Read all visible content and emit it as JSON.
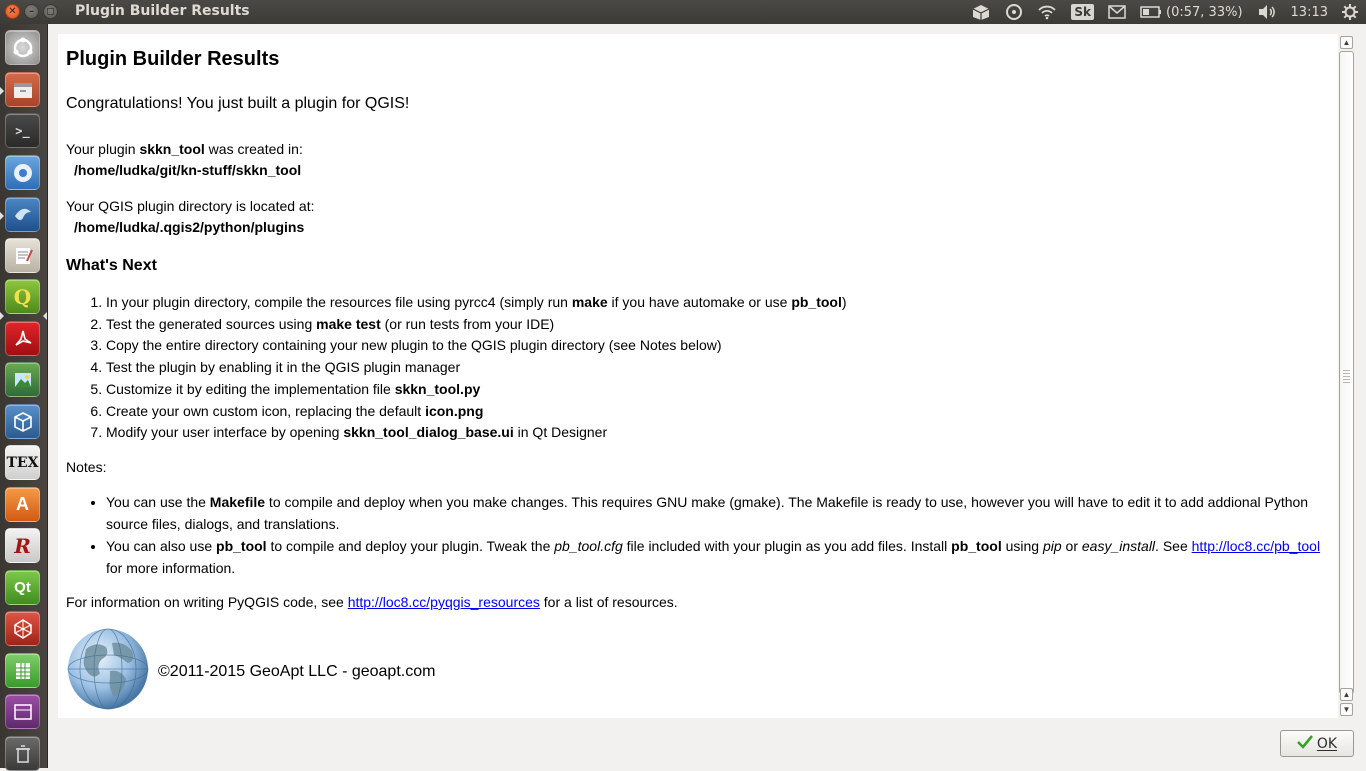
{
  "window": {
    "title": "Plugin Builder Results"
  },
  "panel": {
    "keyboard_layout": "Sk",
    "battery": "(0:57, 33%)",
    "clock": "13:13"
  },
  "launcher": {
    "items": [
      "ubuntu-dash",
      "file-manager",
      "terminal",
      "chromium",
      "thunderbird",
      "text-editor",
      "qgis",
      "pdf-reader",
      "image-viewer",
      "virtualbox",
      "texmaker",
      "software-center",
      "rstudio",
      "qt-creator",
      "network-tool",
      "spreadsheet",
      "workspace-switcher",
      "trash"
    ]
  },
  "content": {
    "heading": "Plugin Builder Results",
    "congrats": "Congratulations! You just built a plugin for QGIS!",
    "created_prefix": "Your plugin ",
    "plugin_name": "skkn_tool",
    "created_suffix": " was created in:",
    "created_path": "/home/ludka/git/kn-stuff/skkn_tool",
    "plugindir_label": "Your QGIS plugin directory is located at:",
    "plugindir_path": "/home/ludka/.qgis2/python/plugins",
    "whats_next": "What's Next",
    "steps": {
      "s1": {
        "a": "In your plugin directory, compile the resources file using pyrcc4 (simply run ",
        "b": "make",
        "c": " if you have automake or use ",
        "d": "pb_tool",
        "e": ")"
      },
      "s2": {
        "a": "Test the generated sources using ",
        "b": "make test",
        "c": " (or run tests from your IDE)"
      },
      "s3": {
        "a": "Copy the entire directory containing your new plugin to the QGIS plugin directory (see Notes below)"
      },
      "s4": {
        "a": "Test the plugin by enabling it in the QGIS plugin manager"
      },
      "s5": {
        "a": "Customize it by editing the implementation file ",
        "b": "skkn_tool.py"
      },
      "s6": {
        "a": "Create your own custom icon, replacing the default ",
        "b": "icon.png"
      },
      "s7": {
        "a": "Modify your user interface by opening ",
        "b": "skkn_tool_dialog_base.ui",
        "c": " in Qt Designer"
      }
    },
    "notes_label": "Notes:",
    "notes": {
      "n1": {
        "a": "You can use the ",
        "b": "Makefile",
        "c": " to compile and deploy when you make changes. This requires GNU make (gmake). The Makefile is ready to use, however you will have to edit it to add addional Python source files, dialogs, and translations."
      },
      "n2": {
        "a": "You can also use ",
        "b": "pb_tool",
        "c": " to compile and deploy your plugin. Tweak the ",
        "d": "pb_tool.cfg",
        "e": " file included with your plugin as you add files. Install ",
        "f": "pb_tool",
        "g": " using ",
        "h": "pip",
        "i": " or ",
        "j": "easy_install",
        "k": ". See ",
        "link": "http://loc8.cc/pb_tool",
        "l": " for more information."
      }
    },
    "info": {
      "a": "For information on writing PyQGIS code, see ",
      "link": "http://loc8.cc/pyqgis_resources",
      "b": " for a list of resources."
    },
    "copyright": "©2011-2015 GeoApt LLC - geoapt.com"
  },
  "buttons": {
    "ok": "OK"
  },
  "colors": {
    "link": "#0000ee",
    "panel": "#3b3a37",
    "window_bg": "#f2f1f0",
    "close_button": "#df4a16"
  }
}
